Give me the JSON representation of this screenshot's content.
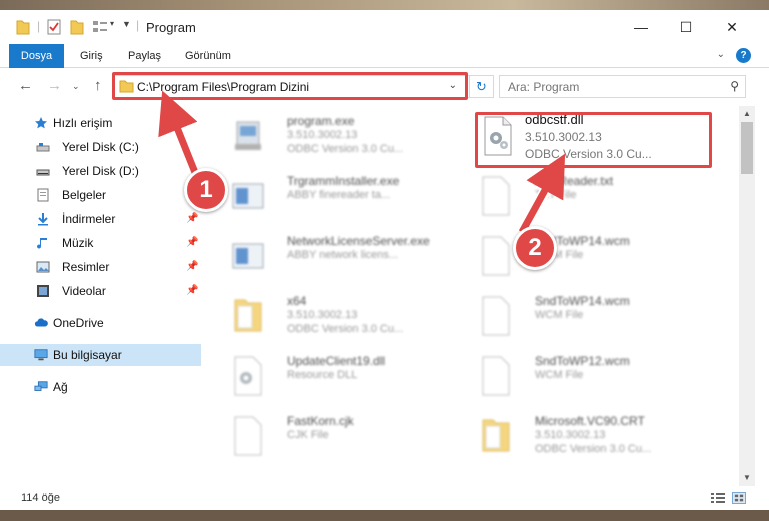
{
  "window": {
    "title": "Program",
    "minimize": "—",
    "maximize": "☐",
    "close": "✕"
  },
  "ribbon": {
    "tabs": [
      "Dosya",
      "Giriş",
      "Paylaş",
      "Görünüm"
    ],
    "help": "?"
  },
  "address": {
    "path": "C:\\Program Files\\Program Dizini",
    "search_placeholder": "Ara: Program"
  },
  "sidebar": {
    "quick_access": "Hızlı erişim",
    "items": [
      {
        "label": "Yerel Disk (C:)",
        "icon": "drive-icon",
        "pinned": false
      },
      {
        "label": "Yerel Disk (D:)",
        "icon": "drive-icon",
        "pinned": false
      },
      {
        "label": "Belgeler",
        "icon": "documents-icon",
        "pinned": true
      },
      {
        "label": "İndirmeler",
        "icon": "download-icon",
        "pinned": true
      },
      {
        "label": "Müzik",
        "icon": "music-icon",
        "pinned": true
      },
      {
        "label": "Resimler",
        "icon": "pictures-icon",
        "pinned": true
      },
      {
        "label": "Videolar",
        "icon": "video-icon",
        "pinned": true
      }
    ],
    "onedrive": "OneDrive",
    "this_pc": "Bu bilgisayar",
    "network": "Ağ"
  },
  "files": [
    {
      "name": "program.exe",
      "line1": "3.510.3002.13",
      "line2": "ODBC Version 3.0 Cu...",
      "icon": "exe-icon"
    },
    {
      "name": "odbcstf.dll",
      "line1": "3.510.3002.13",
      "line2": "ODBC Version 3.0 Cu...",
      "icon": "dll-gear-icon"
    },
    {
      "name": "TrgrammInstaller.exe",
      "line1": "ABBY finereader ta...",
      "line2": "",
      "icon": "exe-window-icon"
    },
    {
      "name": "FineReader.txt",
      "line1": "TXT File",
      "line2": "",
      "icon": "file-icon"
    },
    {
      "name": "NetworkLicenseServer.exe",
      "line1": "ABBY network licens...",
      "line2": "",
      "icon": "exe-window-icon"
    },
    {
      "name": "SndToWP14.wcm",
      "line1": "WCM File",
      "line2": "",
      "icon": "file-icon"
    },
    {
      "name": "x64",
      "line1": "3.510.3002.13",
      "line2": "ODBC Version 3.0 Cu...",
      "icon": "folder-icon"
    },
    {
      "name": "SndToWP14.wcm",
      "line1": "WCM File",
      "line2": "",
      "icon": "file-icon"
    },
    {
      "name": "UpdateClient19.dll",
      "line1": "Resource DLL",
      "line2": "",
      "icon": "dll-gear-icon"
    },
    {
      "name": "SndToWP12.wcm",
      "line1": "WCM File",
      "line2": "",
      "icon": "file-icon"
    },
    {
      "name": "FastKorn.cjk",
      "line1": "CJK File",
      "line2": "",
      "icon": "file-icon"
    },
    {
      "name": "Microsoft.VC90.CRT",
      "line1": "3.510.3002.13",
      "line2": "ODBC Version 3.0 Cu...",
      "icon": "folder-icon"
    }
  ],
  "status": {
    "count": "114 öğe"
  },
  "annotations": {
    "step1": "1",
    "step2": "2",
    "color": "#e04848"
  }
}
